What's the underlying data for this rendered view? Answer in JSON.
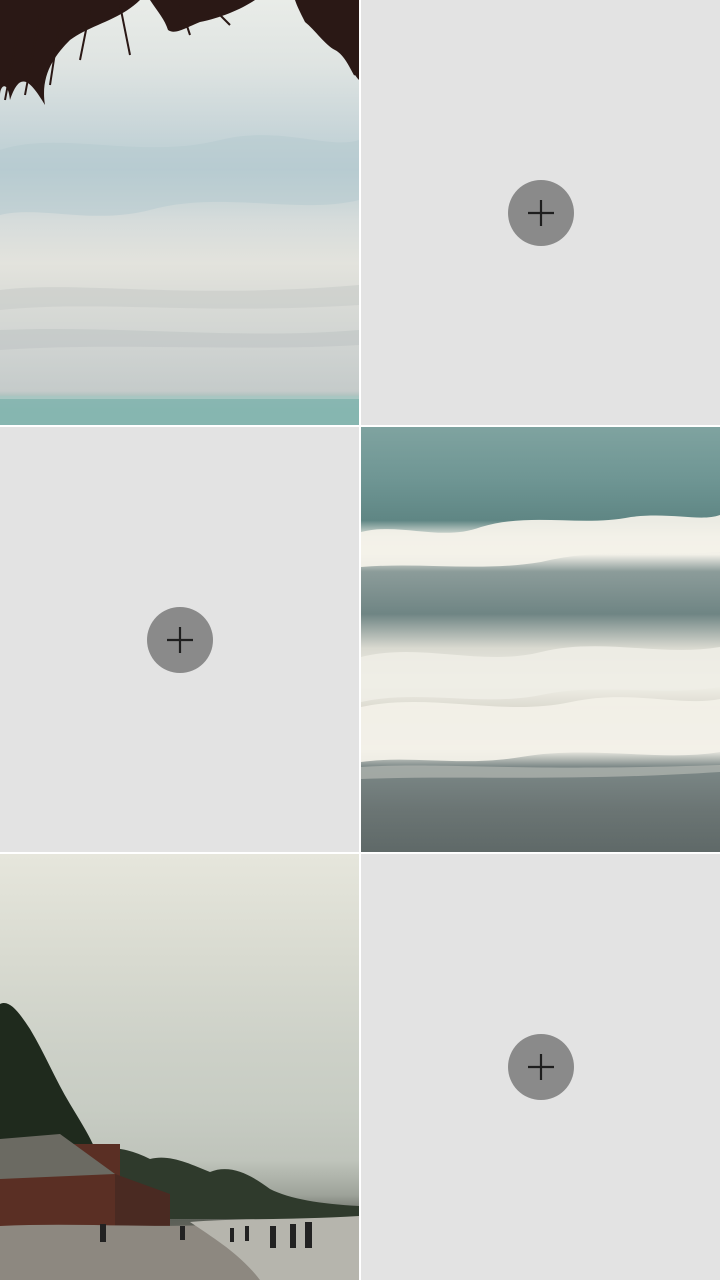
{
  "grid": {
    "cells": [
      {
        "kind": "photo",
        "subject": "sky-and-sea"
      },
      {
        "kind": "empty",
        "action_icon": "plus-icon"
      },
      {
        "kind": "empty",
        "action_icon": "plus-icon"
      },
      {
        "kind": "photo",
        "subject": "waves"
      },
      {
        "kind": "photo",
        "subject": "beach"
      },
      {
        "kind": "empty",
        "action_icon": "plus-icon"
      }
    ]
  },
  "colors": {
    "empty_cell": "#e3e3e3",
    "add_button": "#8a8a8a",
    "plus_stroke": "#1e1e1e",
    "divider": "#ffffff"
  }
}
